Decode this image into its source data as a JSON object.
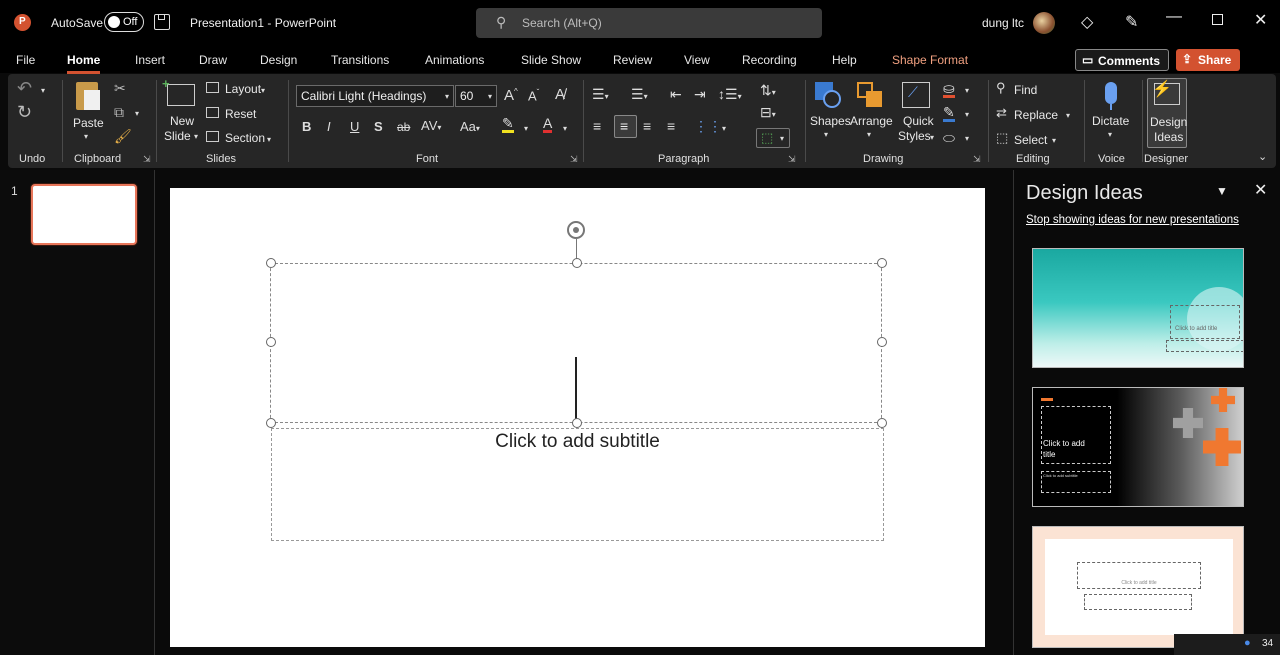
{
  "titlebar": {
    "autosave_label": "AutoSave",
    "autosave_state": "Off",
    "doc_title": "Presentation1 - PowerPoint",
    "search_placeholder": "Search (Alt+Q)",
    "user_name": "dung ltc"
  },
  "tabs": [
    "File",
    "Home",
    "Insert",
    "Draw",
    "Design",
    "Transitions",
    "Animations",
    "Slide Show",
    "Review",
    "View",
    "Recording",
    "Help",
    "Shape Format"
  ],
  "active_tab": "Home",
  "buttons": {
    "comments": "Comments",
    "share": "Share"
  },
  "ribbon": {
    "undo_group": "Undo",
    "clipboard": {
      "paste": "Paste",
      "group": "Clipboard"
    },
    "slides": {
      "new_slide_line1": "New",
      "new_slide_line2": "Slide",
      "layout": "Layout",
      "reset": "Reset",
      "section": "Section",
      "group": "Slides"
    },
    "font": {
      "name": "Calibri Light (Headings)",
      "size": "60",
      "group": "Font"
    },
    "paragraph": {
      "group": "Paragraph"
    },
    "drawing": {
      "shapes": "Shapes",
      "arrange": "Arrange",
      "quick_styles_line1": "Quick",
      "quick_styles_line2": "Styles",
      "group": "Drawing"
    },
    "editing": {
      "find": "Find",
      "replace": "Replace",
      "select": "Select",
      "group": "Editing"
    },
    "voice": {
      "dictate": "Dictate",
      "group": "Voice"
    },
    "designer": {
      "line1": "Design",
      "line2": "Ideas",
      "group": "Designer"
    }
  },
  "slides_pane": {
    "slide_number": "1"
  },
  "slide": {
    "subtitle_placeholder": "Click to add subtitle"
  },
  "design_ideas": {
    "title": "Design Ideas",
    "stop_link": "Stop showing ideas for new presentations",
    "thumb1_title": "Click to add title",
    "thumb2_title_line1": "Click to add",
    "thumb2_title_line2": "title",
    "thumb2_sub": "Click to add subtitle",
    "thumb3_title": "Click to add title"
  },
  "status": {
    "number": "34"
  },
  "colors": {
    "accent": "#d35230",
    "ribbon_bg": "#262626",
    "link": "#ffffff"
  }
}
